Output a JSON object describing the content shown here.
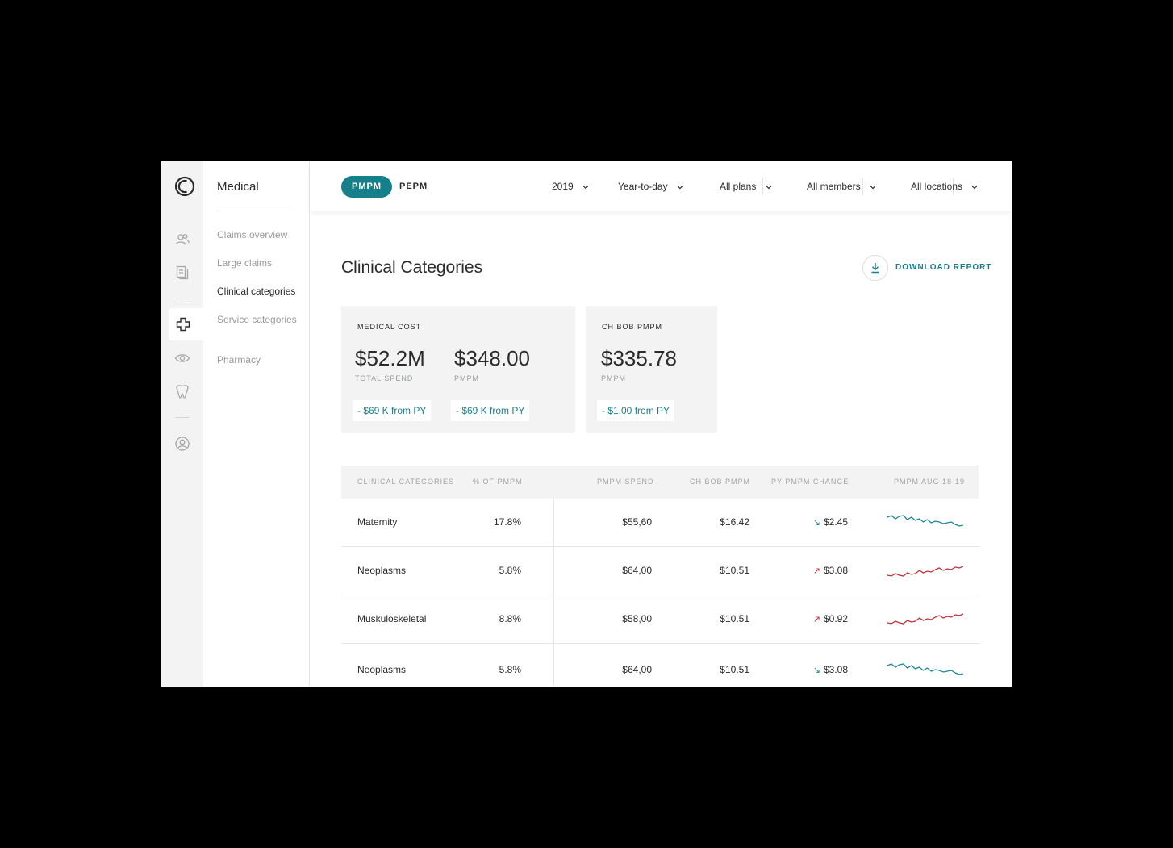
{
  "sidebar": {
    "section_title": "Medical",
    "items": [
      {
        "label": "Claims overview",
        "active": false
      },
      {
        "label": "Large claims",
        "active": false
      },
      {
        "label": "Clinical categories",
        "active": true
      },
      {
        "label": "Service categories",
        "active": false
      },
      {
        "label": "Pharmacy",
        "active": false
      }
    ]
  },
  "rail_icons": [
    "logo-icon",
    "people-icon",
    "documents-icon",
    "medical-cross-icon",
    "eye-icon",
    "tooth-icon",
    "user-profile-icon"
  ],
  "toolbar": {
    "toggle_active": "PMPM",
    "toggle_other": "PEPM",
    "filters": {
      "year": "2019",
      "period": "Year-to-day",
      "plans": "All plans",
      "members": "All members",
      "locations": "All locations"
    }
  },
  "page": {
    "title": "Clinical Categories",
    "download_label": "DOWNLOAD REPORT"
  },
  "cards": {
    "medical_cost": {
      "caption": "MEDICAL COST",
      "total_spend_value": "$52.2M",
      "total_spend_label": "TOTAL SPEND",
      "total_spend_delta": "- $69 K from PY",
      "pmpm_value": "$348.00",
      "pmpm_label": "PMPM",
      "pmpm_delta": "- $69 K from PY"
    },
    "ch_bob": {
      "caption": "CH BOB PMPM",
      "value": "$335.78",
      "label": "PMPM",
      "delta": "- $1.00 from PY"
    }
  },
  "table": {
    "headers": {
      "category": "CLINICAL CATEGORIES",
      "pct": "% OF PMPM",
      "spend": "PMPM SPEND",
      "chbob": "CH BOB PMPM",
      "change": "PY PMPM CHANGE",
      "trend": "PMPM AUG 18-19"
    },
    "rows": [
      {
        "category": "Maternity",
        "pct": "17.8%",
        "spend": "$55,60",
        "chbob": "$16.42",
        "change": "$2.45",
        "direction": "down"
      },
      {
        "category": "Neoplasms",
        "pct": "5.8%",
        "spend": "$64,00",
        "chbob": "$10.51",
        "change": "$3.08",
        "direction": "up"
      },
      {
        "category": "Muskuloskeletal",
        "pct": "8.8%",
        "spend": "$58,00",
        "chbob": "$10.51",
        "change": "$0.92",
        "direction": "up"
      },
      {
        "category": "Neoplasms",
        "pct": "5.8%",
        "spend": "$64,00",
        "chbob": "$10.51",
        "change": "$3.08",
        "direction": "down"
      }
    ]
  },
  "colors": {
    "accent": "#16808a",
    "trend_down": "#1b8797",
    "trend_up": "#c8303a",
    "panel": "#f2f3f2"
  }
}
